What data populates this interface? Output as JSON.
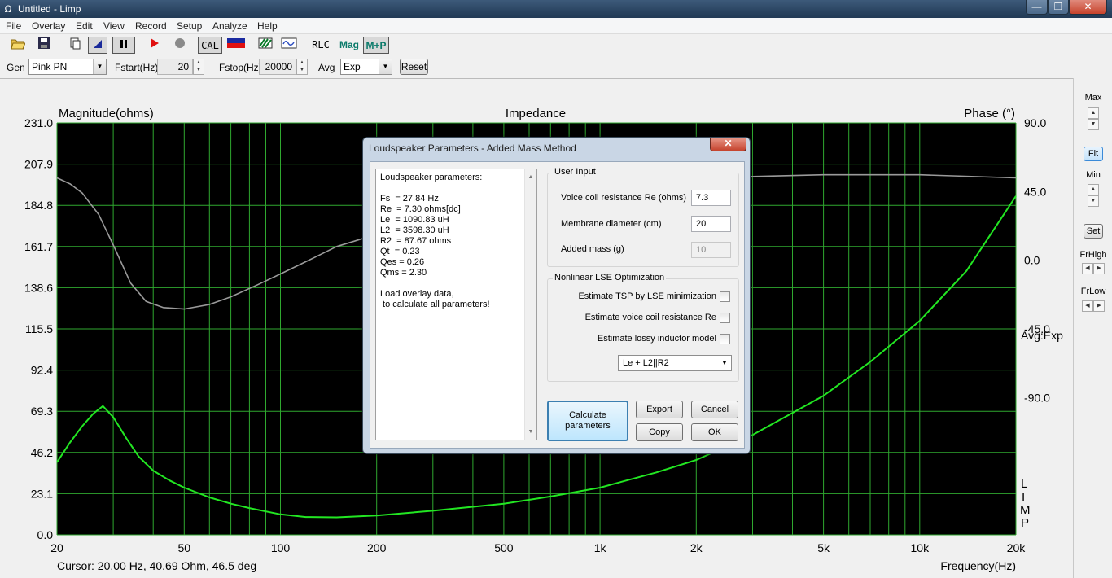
{
  "window": {
    "icon_glyph": "Ω",
    "title": "Untitled - Limp",
    "btn_min": "—",
    "btn_max": "❐",
    "btn_close": "✕"
  },
  "menu": [
    "File",
    "Overlay",
    "Edit",
    "View",
    "Record",
    "Setup",
    "Analyze",
    "Help"
  ],
  "toolbar": {
    "cal_label": "CAL",
    "rlc_label": "RLC",
    "mag_label": "Mag",
    "mp_label": "M+P"
  },
  "gen": {
    "gen_label": "Gen",
    "gen_value": "Pink PN",
    "fstart_label": "Fstart(Hz)",
    "fstart_value": "20",
    "fstop_label": "Fstop(Hz)",
    "fstop_value": "20000",
    "avg_label": "Avg",
    "avg_value": "Exp",
    "reset_label": "Reset"
  },
  "chart_data": {
    "type": "line",
    "title": "Impedance",
    "ylabel_left": "Magnitude(ohms)",
    "ylabel_right": "Phase (°)",
    "xlabel": "Frequency(Hz)",
    "x_scale": "log",
    "xlim": [
      20,
      20000
    ],
    "ylim_left": [
      0,
      231
    ],
    "ylim_right": [
      -180,
      90
    ],
    "grid": true,
    "background": "#000000",
    "grid_color": "#2fa82f",
    "x_tick_labels": [
      "20",
      "50",
      "100",
      "200",
      "500",
      "1k",
      "2k",
      "5k",
      "10k",
      "20k"
    ],
    "x_tick_values": [
      20,
      50,
      100,
      200,
      500,
      1000,
      2000,
      5000,
      10000,
      20000
    ],
    "y_left_tick_labels": [
      "231.0",
      "207.9",
      "184.8",
      "161.7",
      "138.6",
      "115.5",
      "92.4",
      "69.3",
      "46.2",
      "23.1",
      "0.0"
    ],
    "y_right_tick_labels": [
      "90.0",
      "45.0",
      "0.0",
      "-45.0",
      "-90.0"
    ],
    "series": [
      {
        "name": "Magnitude",
        "axis": "left",
        "color": "#22e622",
        "x": [
          20,
          22,
          24,
          26,
          27.84,
          30,
          33,
          36,
          40,
          45,
          50,
          60,
          70,
          80,
          100,
          120,
          150,
          200,
          300,
          500,
          700,
          1000,
          1500,
          2000,
          3000,
          5000,
          7000,
          10000,
          14000,
          20000
        ],
        "y": [
          40.7,
          52,
          61,
          68,
          72.2,
          66,
          54,
          44,
          36,
          30.5,
          26.5,
          21,
          17.5,
          15,
          11.5,
          10,
          9.8,
          10.8,
          13.5,
          17.5,
          21.5,
          26.5,
          35,
          42,
          56,
          78,
          97,
          120,
          148,
          190
        ]
      },
      {
        "name": "Phase",
        "axis": "right",
        "color": "#9a9a9a",
        "x": [
          20,
          22,
          24,
          27,
          30,
          34,
          38,
          43,
          50,
          60,
          70,
          85,
          100,
          120,
          150,
          200,
          300,
          500,
          1000,
          2000,
          5000,
          10000,
          20000
        ],
        "y": [
          54,
          50,
          44,
          30,
          10,
          -15,
          -27,
          -31,
          -32,
          -29,
          -24,
          -16,
          -9,
          -1,
          9,
          17,
          27,
          38,
          48,
          54,
          56,
          56,
          54
        ]
      }
    ],
    "annotations": [
      "Avg:Exp"
    ]
  },
  "status": {
    "cursor": "Cursor: 20.00 Hz, 40.69 Ohm, 46.5 deg",
    "avg_label": "Avg:Exp",
    "brand": [
      "L",
      "I",
      "M",
      "P"
    ]
  },
  "rightpanel": {
    "max": "Max",
    "fit": "Fit",
    "min": "Min",
    "set": "Set",
    "frhigh": "FrHigh",
    "frlow": "FrLow"
  },
  "dialog": {
    "title": "Loudspeaker Parameters - Added Mass Method",
    "close_glyph": "✕",
    "params_lines": [
      "Loudspeaker parameters:",
      "",
      "Fs  = 27.84 Hz",
      "Re  = 7.30 ohms[dc]",
      "Le  = 1090.83 uH",
      "L2  = 3598.30 uH",
      "R2  = 87.67 ohms",
      "Qt  = 0.23",
      "Qes = 0.26",
      "Qms = 2.30",
      "",
      "Load overlay data,",
      " to calculate all parameters!"
    ],
    "user_input_title": "User Input",
    "re_label": "Voice coil resistance Re (ohms)",
    "re_value": "7.3",
    "diam_label": "Membrane diameter (cm)",
    "diam_value": "20",
    "mass_label": "Added mass (g)",
    "mass_value": "10",
    "lse_title": "Nonlinear LSE Optimization",
    "chk1": "Estimate TSP by LSE minimization",
    "chk2": "Estimate voice coil resistance Re",
    "chk3": "Estimate lossy inductor model",
    "model_value": "Le + L2||R2",
    "calc_label_1": "Calculate",
    "calc_label_2": "parameters",
    "export_label": "Export",
    "cancel_label": "Cancel",
    "copy_label": "Copy",
    "ok_label": "OK"
  }
}
